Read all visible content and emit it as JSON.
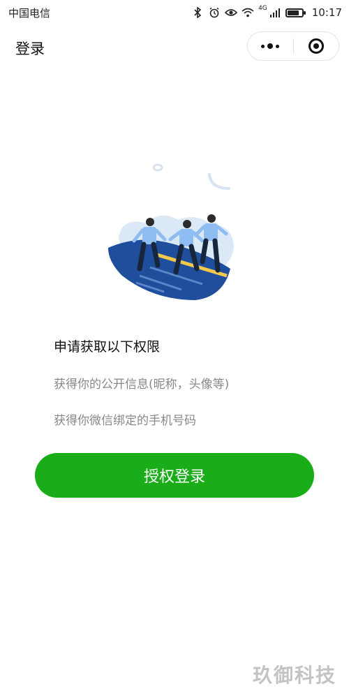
{
  "status_bar": {
    "carrier": "中国电信",
    "network": "4G",
    "time": "10:17",
    "battery_level": 0.8,
    "icons": [
      "bluetooth-icon",
      "alarm-icon",
      "eye-icon",
      "wifi-icon",
      "signal-icon",
      "battery-icon"
    ]
  },
  "nav": {
    "title": "登录",
    "capsule_icons": [
      "more-dots-icon",
      "close-target-icon"
    ]
  },
  "permissions": {
    "title": "申请获取以下权限",
    "items": [
      "获得你的公开信息(昵称，头像等)",
      "获得你微信绑定的手机号码"
    ]
  },
  "actions": {
    "auth_label": "授权登录"
  },
  "watermark": {
    "text": "玖御科技"
  },
  "colors": {
    "primary": "#1aad19",
    "muted_text": "#888888",
    "illustration_blue": "#1f4e9c",
    "illustration_light": "#d9e8f7"
  }
}
